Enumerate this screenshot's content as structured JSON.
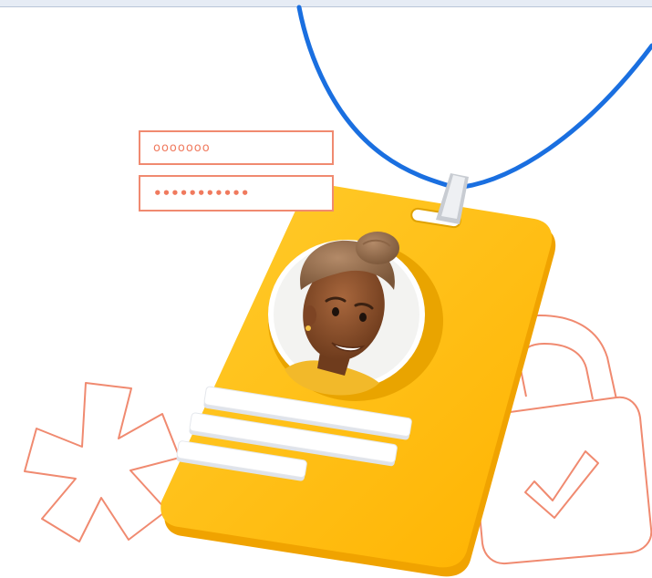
{
  "login_form": {
    "username_mask": "ooooooo",
    "password_mask": "•••••••••••"
  },
  "colors": {
    "lanyard": "#1a6fe0",
    "badge": "#ffc21a",
    "badge_shadow": "#f0a300",
    "outline_accent": "#f08a70",
    "field_mask": "#f07a5e"
  },
  "icons": [
    "lanyard-icon",
    "badge-clip-icon",
    "id-badge-icon",
    "avatar",
    "asterisk-icon",
    "padlock-icon",
    "checkmark-icon"
  ]
}
